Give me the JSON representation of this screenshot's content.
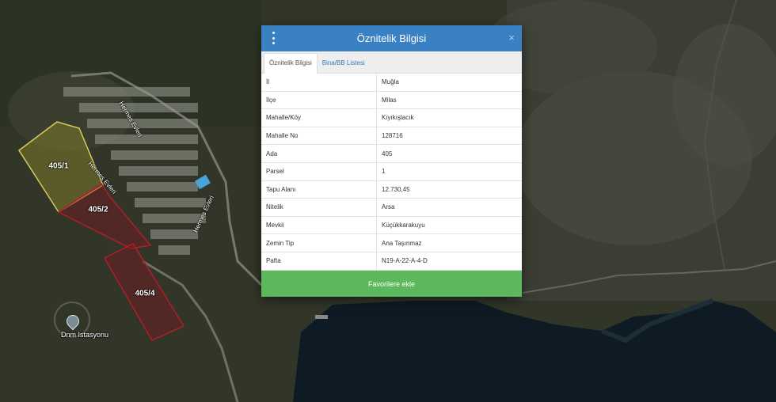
{
  "modal": {
    "title": "Öznitelik Bilgisi",
    "close_symbol": "×",
    "tabs": [
      {
        "label": "Öznitelik Bilgisi",
        "active": true
      },
      {
        "label": "Bina/BB Listesi",
        "active": false
      }
    ],
    "rows": [
      {
        "key": "İl",
        "value": "Muğla"
      },
      {
        "key": "İlçe",
        "value": "Milas"
      },
      {
        "key": "Mahalle/Köy",
        "value": "Kıyıkışlacık"
      },
      {
        "key": "Mahalle No",
        "value": "128716"
      },
      {
        "key": "Ada",
        "value": "405"
      },
      {
        "key": "Parsel",
        "value": "1"
      },
      {
        "key": "Tapu Alanı",
        "value": "12.730,45"
      },
      {
        "key": "Nitelik",
        "value": "Arsa"
      },
      {
        "key": "Mevkii",
        "value": "Küçükkarakuyu"
      },
      {
        "key": "Zemin Tip",
        "value": "Ana Taşınmaz"
      },
      {
        "key": "Pafta",
        "value": "N19-A-22-A-4-D"
      }
    ],
    "favorite_button": "Favorilere ekle"
  },
  "map": {
    "parcels": [
      "405/1",
      "405/2",
      "405/4"
    ],
    "roads": [
      "Hermes Evleri",
      "Hermes Evleri",
      "Hermes Evleri"
    ],
    "place": "Dnm Istasyonu",
    "colors": {
      "parcel_selected": "#d8c85a",
      "parcel_other": "#b01e2a",
      "header": "#3a81c3",
      "button": "#5cb85c"
    }
  }
}
